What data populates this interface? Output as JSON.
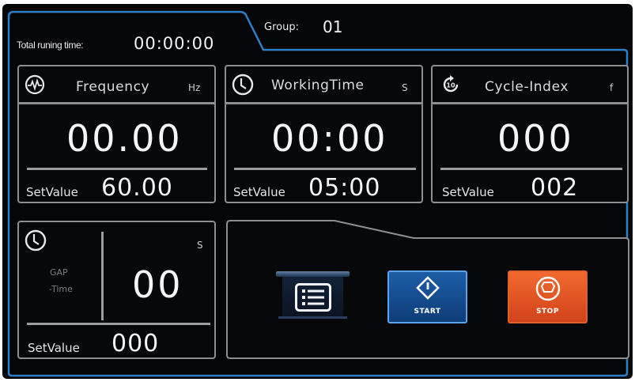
{
  "header": {
    "total_time_label": "Total runing time:",
    "total_time": "00:00:00",
    "group_label": "Group:",
    "group": "01"
  },
  "panels": {
    "frequency": {
      "title": "Frequency",
      "unit": "Hz",
      "value": "00.00",
      "set_label": "SetValue",
      "set_value": "60.00",
      "icon": "waveform-icon"
    },
    "working_time": {
      "title": "WorkingTime",
      "unit": "S",
      "value": "00:00",
      "set_label": "SetValue",
      "set_value": "05:00",
      "icon": "clock-icon"
    },
    "cycle_index": {
      "title": "Cycle-Index",
      "unit": "f",
      "value": "000",
      "set_label": "SetValue",
      "set_value": "002",
      "icon": "cycle-icon",
      "icon_text": "10"
    },
    "gap_time": {
      "title_line1": "GAP",
      "title_line2": "-Time",
      "unit": "S",
      "value": "00",
      "set_label": "SetValue",
      "set_value": "000",
      "icon": "clock-icon"
    }
  },
  "controls": {
    "menu": {
      "icon": "list-icon"
    },
    "start": {
      "label": "START",
      "icon": "start-diamond-icon"
    },
    "stop": {
      "label": "STOP",
      "icon": "stop-octagon-icon"
    }
  },
  "colors": {
    "accent_blue": "#2f7fc8",
    "stop_orange": "#e2531f",
    "panel_border": "#8b8f93",
    "background": "#050608"
  }
}
